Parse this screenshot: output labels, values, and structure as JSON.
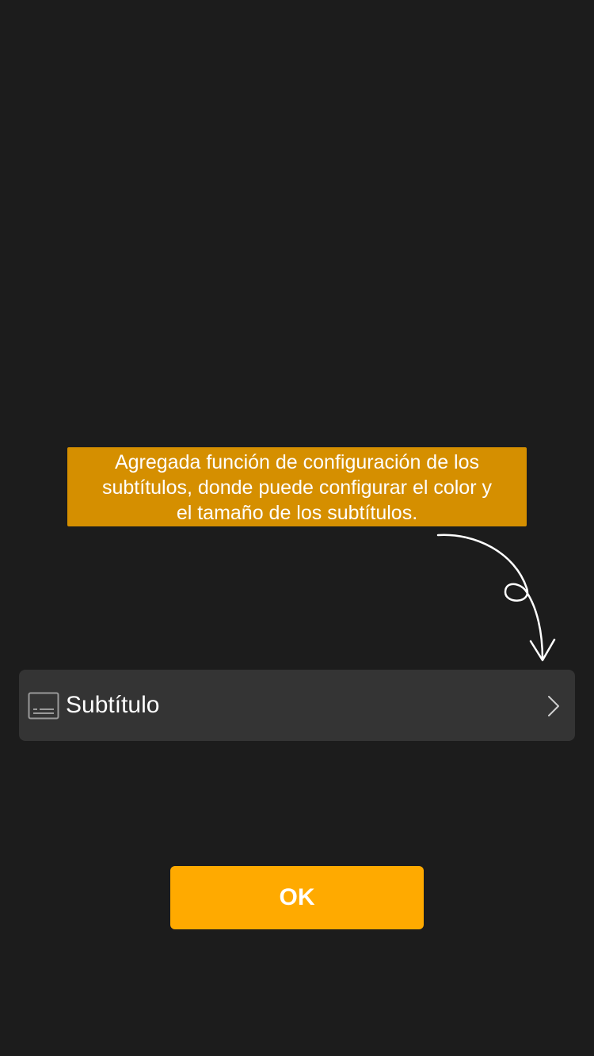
{
  "tooltip": {
    "line1": "Agregada función de configuración de los",
    "line2": "subtítulos, donde puede configurar el color y",
    "line3": "el tamaño de los subtítulos."
  },
  "settings_row": {
    "icon": "subtitles-icon",
    "label": "Subtítulo",
    "chevron": "chevron-right-icon"
  },
  "ok_button": {
    "label": "OK"
  },
  "colors": {
    "background": "#1c1c1c",
    "tooltip_bg": "#d58f00",
    "row_bg": "#343434",
    "button_bg": "#ffaa00"
  }
}
